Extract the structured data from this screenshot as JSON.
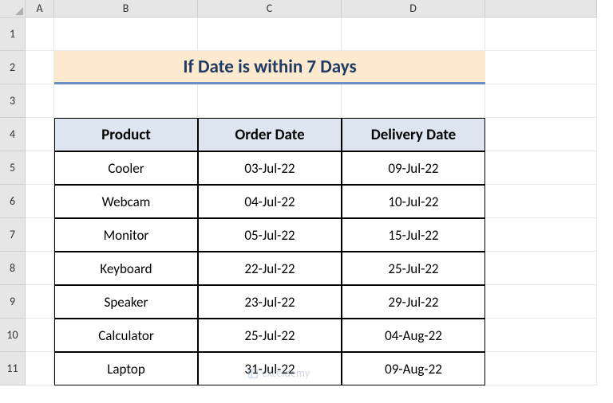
{
  "columns": [
    "A",
    "B",
    "C",
    "D"
  ],
  "rows": [
    "1",
    "2",
    "3",
    "4",
    "5",
    "6",
    "7",
    "8",
    "9",
    "10",
    "11"
  ],
  "title": "If Date is within 7 Days",
  "headers": {
    "product": "Product",
    "order": "Order Date",
    "delivery": "Delivery Date"
  },
  "data": [
    {
      "product": "Cooler",
      "order": "03-Jul-22",
      "delivery": "09-Jul-22"
    },
    {
      "product": "Webcam",
      "order": "04-Jul-22",
      "delivery": "10-Jul-22"
    },
    {
      "product": "Monitor",
      "order": "05-Jul-22",
      "delivery": "15-Jul-22"
    },
    {
      "product": "Keyboard",
      "order": "22-Jul-22",
      "delivery": "25-Jul-22"
    },
    {
      "product": "Speaker",
      "order": "23-Jul-22",
      "delivery": "29-Jul-22"
    },
    {
      "product": "Calculator",
      "order": "25-Jul-22",
      "delivery": "04-Aug-22"
    },
    {
      "product": "Laptop",
      "order": "31-Jul-22",
      "delivery": "09-Aug-22"
    }
  ],
  "watermark": "exceldemy"
}
